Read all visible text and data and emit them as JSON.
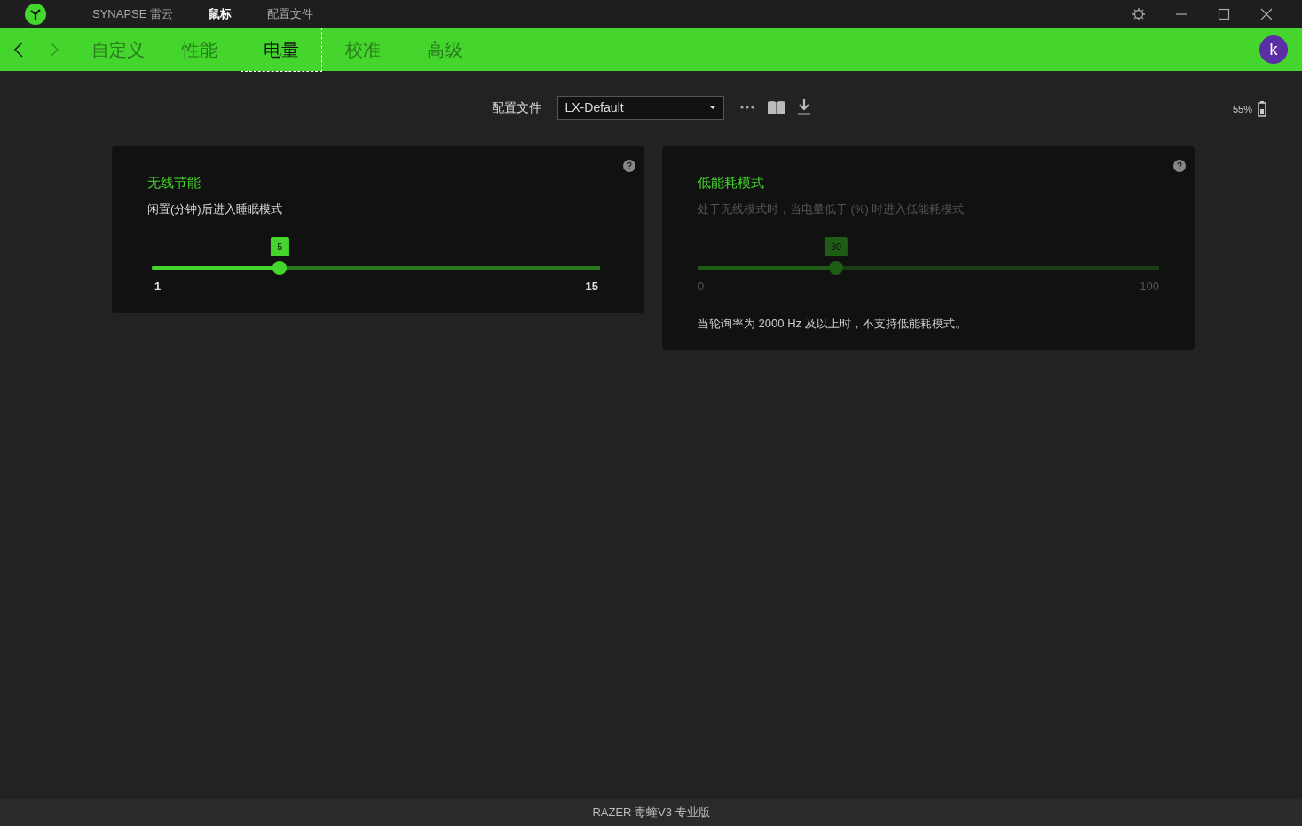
{
  "title_bar": {
    "tabs": [
      {
        "label": "SYNAPSE 雷云",
        "selected": false
      },
      {
        "label": "鼠标",
        "selected": true
      },
      {
        "label": "配置文件",
        "selected": false
      }
    ]
  },
  "nav": {
    "back_disabled": false,
    "forward_disabled": true,
    "tabs": [
      {
        "label": "自定义",
        "selected": false
      },
      {
        "label": "性能",
        "selected": false
      },
      {
        "label": "电量",
        "selected": true
      },
      {
        "label": "校准",
        "selected": false
      },
      {
        "label": "高级",
        "selected": false
      }
    ],
    "avatar": "k"
  },
  "profile": {
    "label": "配置文件",
    "value": "LX-Default"
  },
  "battery": {
    "reading": "55%"
  },
  "cards": [
    {
      "title": "无线节能",
      "description": "闲置(分钟)后进入睡眠模式",
      "disabled": false,
      "slider": {
        "value": "5",
        "level": 0.286,
        "min": "1",
        "max": "15"
      }
    },
    {
      "title": "低能耗模式",
      "description": "处于无线模式时，当电量低于 (%) 时进入低能耗模式",
      "disabled": true,
      "slider": {
        "value": "30",
        "level": 0.3,
        "min": "0",
        "max": "100"
      },
      "note": "当轮询率为 2000 Hz 及以上时，不支持低能耗模式。"
    }
  ],
  "footer": "RAZER 毒蝰V3 专业版"
}
